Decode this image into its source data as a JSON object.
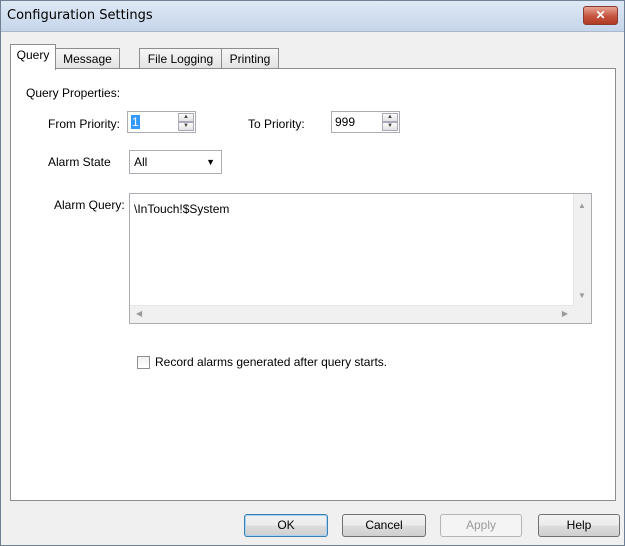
{
  "window": {
    "title": "Configuration Settings",
    "close_glyph": "✕"
  },
  "tabs": [
    {
      "label": "Query",
      "active": true
    },
    {
      "label": "Message",
      "active": false
    },
    {
      "label": "File Logging",
      "active": false
    },
    {
      "label": "Printing",
      "active": false
    }
  ],
  "query": {
    "group_label": "Query Properties:",
    "from_priority_label": "From Priority:",
    "from_priority_value": "1",
    "to_priority_label": "To Priority:",
    "to_priority_value": "999",
    "alarm_state_label": "Alarm State",
    "alarm_state_value": "All",
    "alarm_query_label": "Alarm Query:",
    "alarm_query_value": "\\InTouch!$System",
    "record_checkbox_label": "Record alarms generated after query starts.",
    "record_checked": false
  },
  "buttons": {
    "ok": "OK",
    "cancel": "Cancel",
    "apply": "Apply",
    "help": "Help"
  },
  "icons": {
    "spin_up": "▲",
    "spin_down": "▼",
    "dropdown": "▼",
    "scroll_up": "▲",
    "scroll_down": "▼",
    "scroll_left": "◀",
    "scroll_right": "▶"
  }
}
